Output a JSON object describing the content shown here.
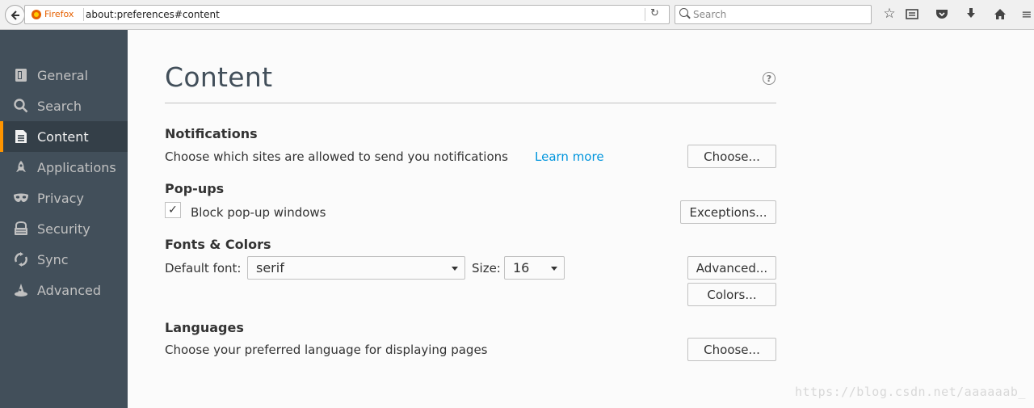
{
  "toolbar": {
    "browser_label": "Firefox",
    "url": "about:preferences#content",
    "search_placeholder": "Search",
    "icons": [
      "back-icon",
      "reload-icon",
      "search-icon",
      "bookmark-star-icon",
      "reading-list-icon",
      "pocket-icon",
      "download-icon",
      "home-icon"
    ]
  },
  "sidebar": {
    "items": [
      {
        "label": "General",
        "icon": "general-icon"
      },
      {
        "label": "Search",
        "icon": "search-icon"
      },
      {
        "label": "Content",
        "icon": "content-icon",
        "active": true
      },
      {
        "label": "Applications",
        "icon": "applications-icon"
      },
      {
        "label": "Privacy",
        "icon": "privacy-mask-icon"
      },
      {
        "label": "Security",
        "icon": "security-icon"
      },
      {
        "label": "Sync",
        "icon": "sync-icon"
      },
      {
        "label": "Advanced",
        "icon": "advanced-wizard-icon"
      }
    ],
    "active_color": "#ff9500"
  },
  "main": {
    "title": "Content",
    "notifications": {
      "heading": "Notifications",
      "description": "Choose which sites are allowed to send you notifications",
      "learn_more": "Learn more",
      "choose_button": "Choose..."
    },
    "popups": {
      "heading": "Pop-ups",
      "block_label": "Block pop-up windows",
      "block_checked": true,
      "exceptions_button": "Exceptions..."
    },
    "fonts": {
      "heading": "Fonts & Colors",
      "default_font_label": "Default font:",
      "default_font_value": "serif",
      "size_label": "Size:",
      "size_value": "16",
      "advanced_button": "Advanced...",
      "colors_button": "Colors..."
    },
    "languages": {
      "heading": "Languages",
      "description": "Choose your preferred language for displaying pages",
      "choose_button": "Choose..."
    }
  },
  "watermark": "https://blog.csdn.net/aaaaaab_",
  "colors": {
    "sidebar_bg": "#424f5a",
    "link": "#0095dd",
    "accent": "#ff9500"
  }
}
